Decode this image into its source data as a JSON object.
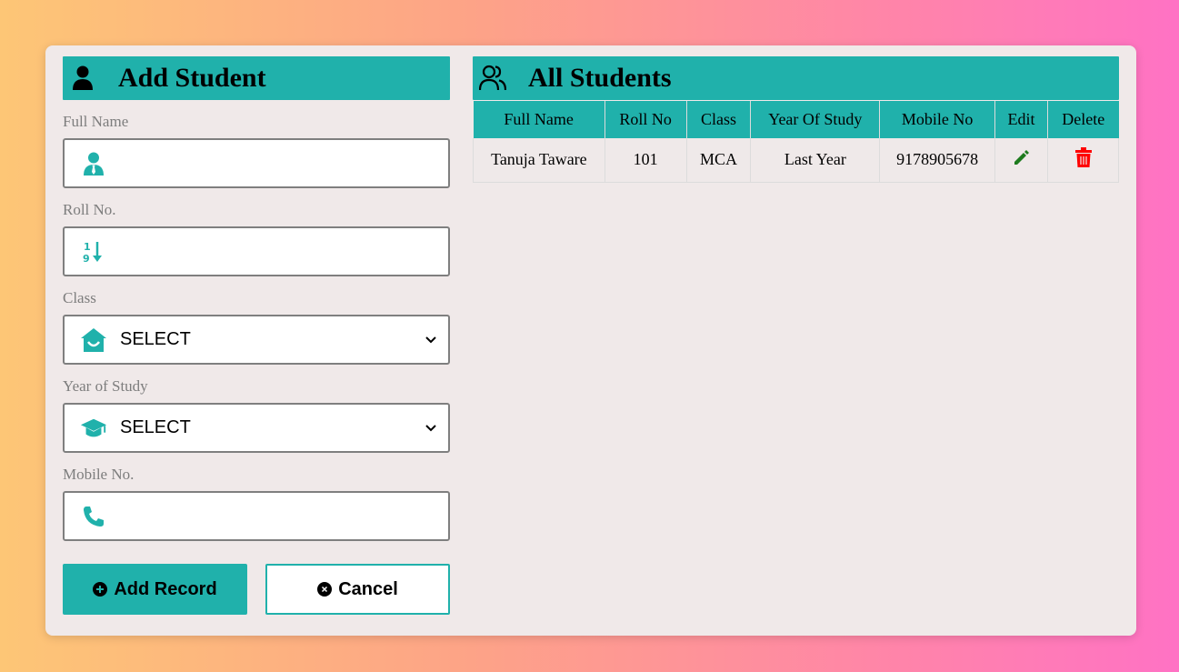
{
  "add_panel": {
    "title": "Add Student",
    "fields": {
      "full_name": {
        "label": "Full Name",
        "value": ""
      },
      "roll_no": {
        "label": "Roll No.",
        "value": ""
      },
      "class": {
        "label": "Class",
        "selected": "SELECT"
      },
      "year_of_study": {
        "label": "Year of Study",
        "selected": "SELECT"
      },
      "mobile_no": {
        "label": "Mobile No.",
        "value": ""
      }
    },
    "buttons": {
      "add": "Add Record",
      "cancel": "Cancel"
    }
  },
  "list_panel": {
    "title": "All Students",
    "columns": [
      "Full Name",
      "Roll No",
      "Class",
      "Year Of Study",
      "Mobile No",
      "Edit",
      "Delete"
    ],
    "rows": [
      {
        "full_name": "Tanuja Taware",
        "roll_no": "101",
        "class": "MCA",
        "year": "Last Year",
        "mobile": "9178905678"
      }
    ]
  },
  "colors": {
    "accent": "#20b1ab",
    "edit_icon": "#1e7b1e",
    "delete_icon": "#ff0000",
    "card_bg": "#f0e9e9"
  },
  "icons": {
    "add_header": "user-icon",
    "list_header": "users-icon",
    "full_name": "user-tie-icon",
    "roll_no": "sort-numeric-icon",
    "class": "school-icon",
    "year": "graduation-cap-icon",
    "mobile": "phone-icon",
    "edit": "pencil-icon",
    "delete": "trash-icon"
  }
}
